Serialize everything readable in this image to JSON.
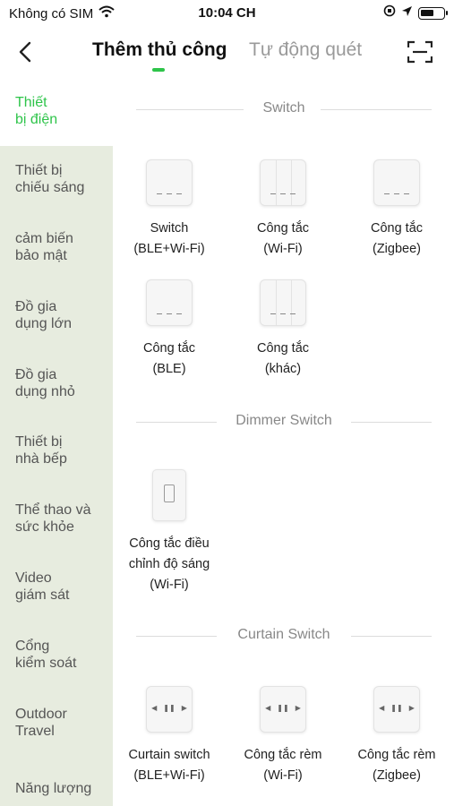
{
  "status_bar": {
    "carrier": "Không có SIM",
    "time": "10:04 CH"
  },
  "header": {
    "tab_manual": "Thêm thủ công",
    "tab_auto": "Tự động quét"
  },
  "sidebar": {
    "items": [
      {
        "label": "Thiết\nbị điện"
      },
      {
        "label": "Thiết bị\nchiếu sáng"
      },
      {
        "label": "cảm biến\nbảo mật"
      },
      {
        "label": "Đồ gia\ndụng lớn"
      },
      {
        "label": "Đồ gia\ndụng nhỏ"
      },
      {
        "label": "Thiết bị\nnhà bếp"
      },
      {
        "label": "Thể thao và\nsức khỏe"
      },
      {
        "label": "Video\ngiám sát"
      },
      {
        "label": "Cổng\nkiểm soát"
      },
      {
        "label": "Outdoor\nTravel"
      },
      {
        "label": "Năng lượng"
      }
    ]
  },
  "sections": [
    {
      "title": "Switch",
      "devices": [
        {
          "label": "Switch\n(BLE+Wi-Fi)",
          "icon": "switch-3gang-icon"
        },
        {
          "label": "Công tắc\n(Wi-Fi)",
          "icon": "switch-3gang-icon"
        },
        {
          "label": "Công tắc\n(Zigbee)",
          "icon": "switch-3gang-icon"
        },
        {
          "label": "Công tắc\n(BLE)",
          "icon": "switch-3gang-icon"
        },
        {
          "label": "Công tắc\n(khác)",
          "icon": "switch-3gang-icon"
        }
      ]
    },
    {
      "title": "Dimmer Switch",
      "devices": [
        {
          "label": "Công tắc điều\nchỉnh độ sáng\n(Wi-Fi)",
          "icon": "dimmer-switch-icon"
        }
      ]
    },
    {
      "title": "Curtain Switch",
      "devices": [
        {
          "label": "Curtain switch\n(BLE+Wi-Fi)",
          "icon": "curtain-switch-icon"
        },
        {
          "label": "Công tắc rèm\n(Wi-Fi)",
          "icon": "curtain-switch-icon"
        },
        {
          "label": "Công tắc rèm\n(Zigbee)",
          "icon": "curtain-switch-icon"
        }
      ]
    }
  ],
  "colors": {
    "accent": "#2ec44a",
    "sidebar_bg": "#e7ecdf"
  }
}
